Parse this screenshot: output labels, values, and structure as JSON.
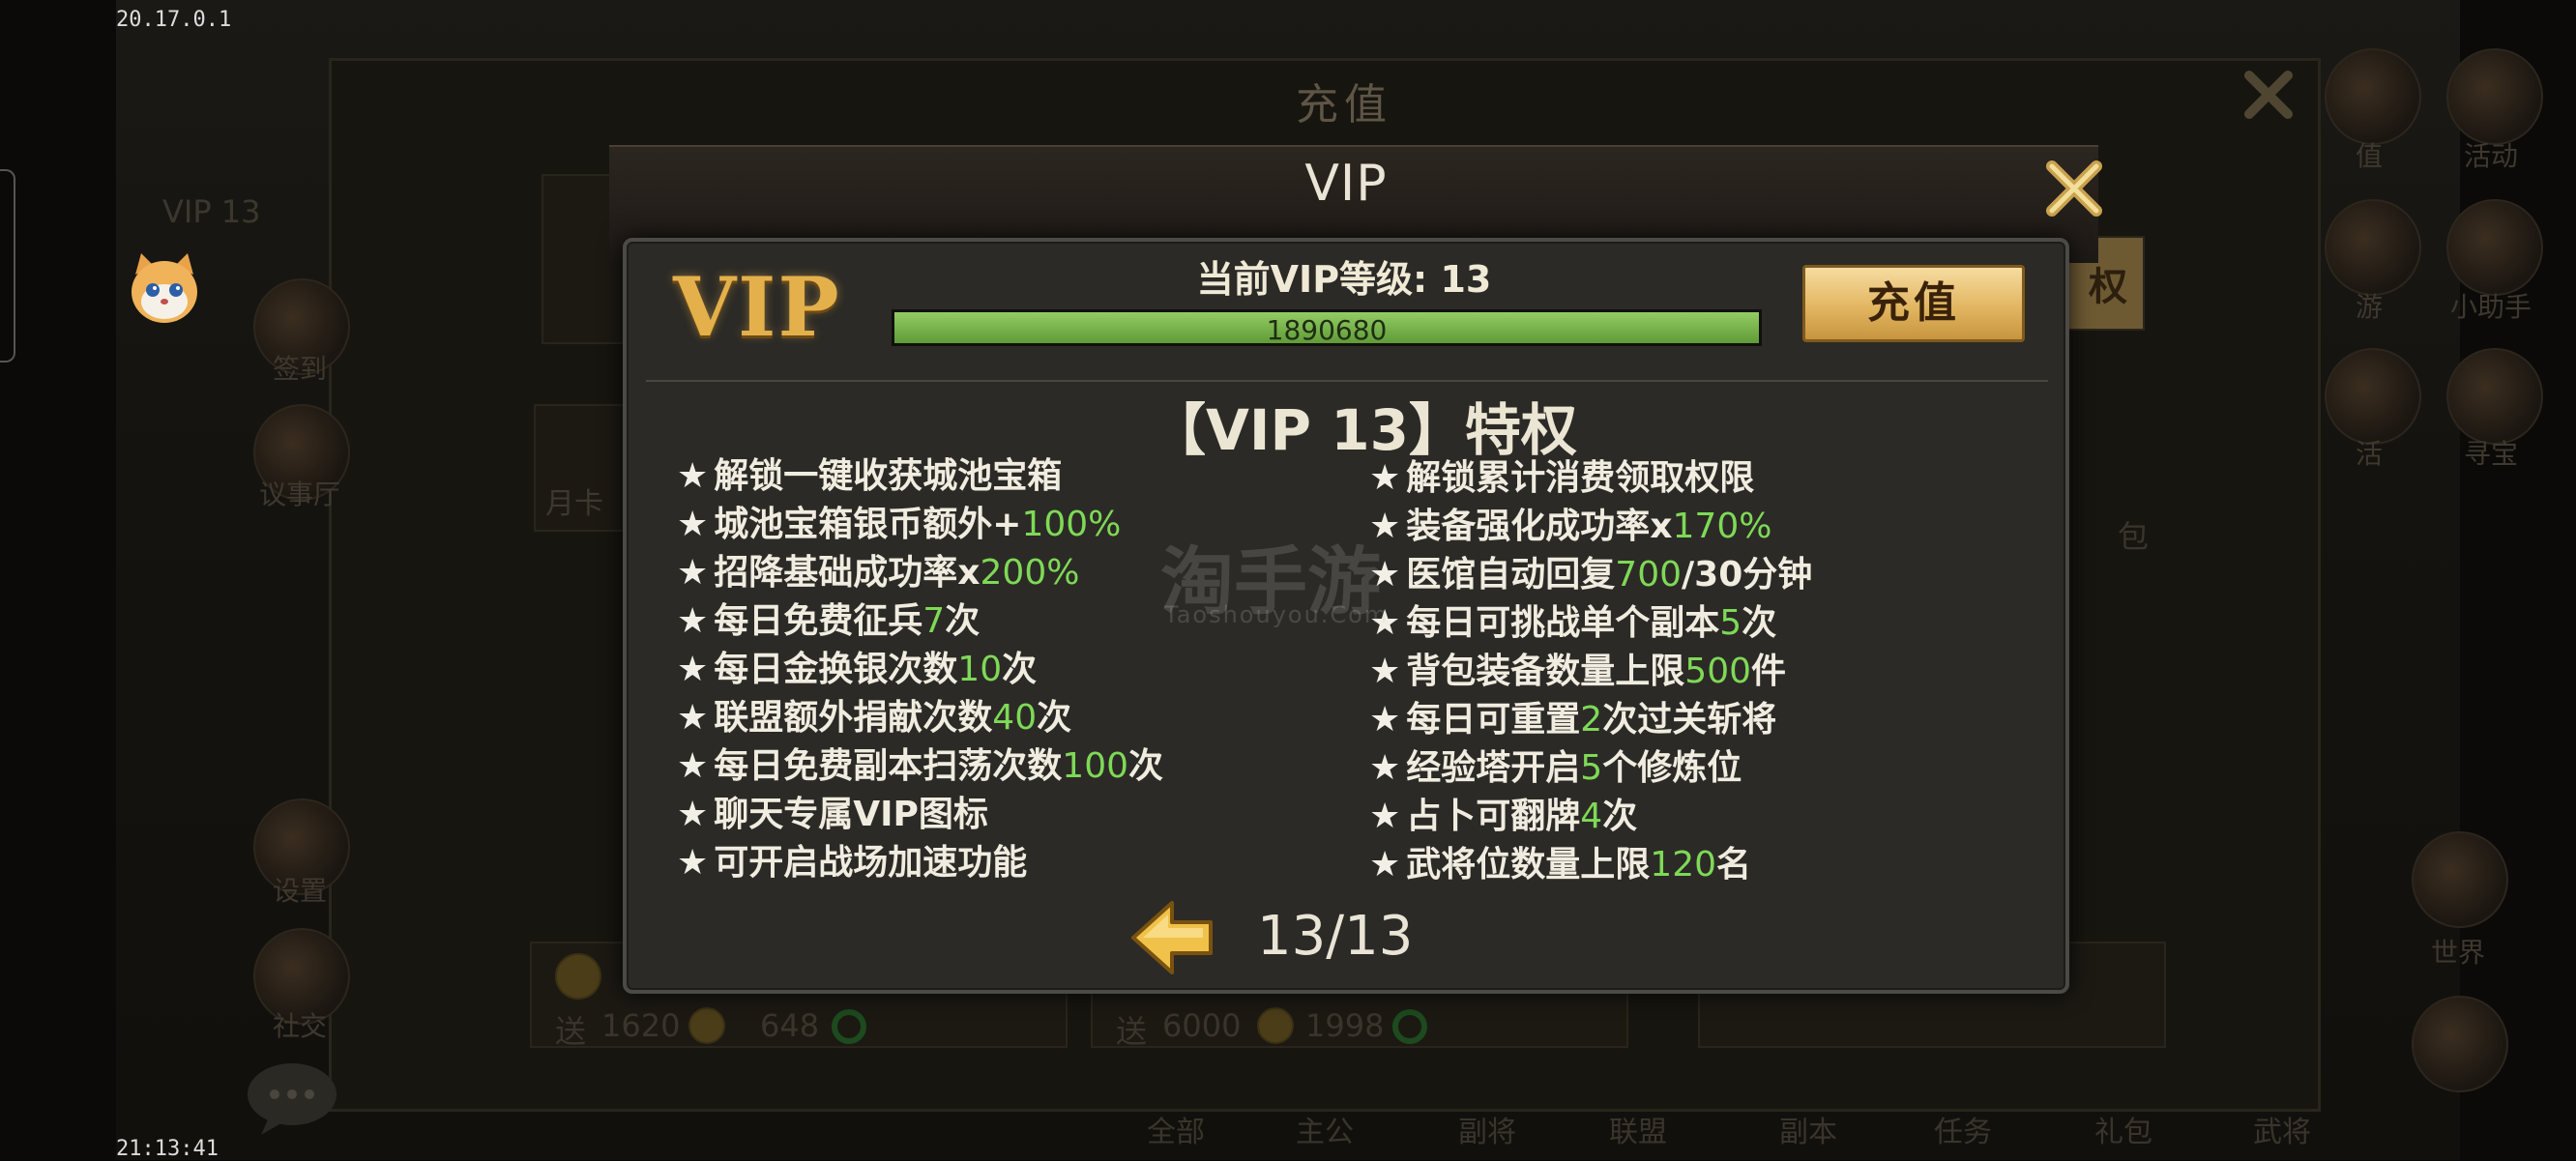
{
  "status": {
    "top_left": "20.17.0.1",
    "bottom_left": "21:13:41"
  },
  "background": {
    "title": "充值",
    "vip_label": "VIP 13",
    "left_icons": [
      "签到",
      "议事厅",
      "设置",
      "社交"
    ],
    "right_icons_top": [
      "值",
      "活动"
    ],
    "right_icons_mid": [
      "游",
      "小助手"
    ],
    "right_icons_low": [
      "活",
      "寻宝"
    ],
    "right_world": "世界",
    "right_partial": "权",
    "right_bag": "包",
    "month_card": "月卡",
    "cards": [
      {
        "send": "送",
        "amount": "1620",
        "jade": "648"
      },
      {
        "send": "送",
        "amount": "6000",
        "jade": "1998"
      }
    ],
    "bottom_tabs": [
      "全部",
      "主公",
      "副将",
      "联盟",
      "副本",
      "任务",
      "礼包",
      "武将",
      "世界"
    ]
  },
  "modal": {
    "title": "VIP",
    "logo": "VIP",
    "level_text": "当前VIP等级: 13",
    "progress_value": "1890680",
    "progress_fraction": 1.0,
    "recharge_button": "充值",
    "privilege_title": "【VIP 13】特权",
    "left_privileges": [
      {
        "star": "★",
        "pre": "解锁一键收获城池宝箱",
        "hl": "",
        "post": ""
      },
      {
        "star": "★",
        "pre": "城池宝箱银币额外+",
        "hl": "100%",
        "post": ""
      },
      {
        "star": "★",
        "pre": "招降基础成功率x",
        "hl": "200%",
        "post": ""
      },
      {
        "star": "★",
        "pre": "每日免费征兵",
        "hl": "7",
        "post": "次"
      },
      {
        "star": "★",
        "pre": "每日金换银次数",
        "hl": "10",
        "post": "次"
      },
      {
        "star": "★",
        "pre": "联盟额外捐献次数",
        "hl": "40",
        "post": "次"
      },
      {
        "star": "★",
        "pre": "每日免费副本扫荡次数",
        "hl": "100",
        "post": "次"
      },
      {
        "star": "★",
        "pre": "聊天专属VIP图标",
        "hl": "",
        "post": ""
      },
      {
        "star": "★",
        "pre": "可开启战场加速功能",
        "hl": "",
        "post": ""
      }
    ],
    "right_privileges": [
      {
        "star": "★",
        "pre": "解锁累计消费领取权限",
        "hl": "",
        "post": ""
      },
      {
        "star": "★",
        "pre": "装备强化成功率x",
        "hl": "170%",
        "post": ""
      },
      {
        "star": "★",
        "pre": "医馆自动回复",
        "hl": "700",
        "post": "/30分钟"
      },
      {
        "star": "★",
        "pre": "每日可挑战单个副本",
        "hl": "5",
        "post": "次"
      },
      {
        "star": "★",
        "pre": "背包装备数量上限",
        "hl": "500",
        "post": "件"
      },
      {
        "star": "★",
        "pre": "每日可重置",
        "hl": "2",
        "post": "次过关斩将"
      },
      {
        "star": "★",
        "pre": "经验塔开启",
        "hl": "5",
        "post": "个修炼位"
      },
      {
        "star": "★",
        "pre": "占卜可翻牌",
        "hl": "4",
        "post": "次"
      },
      {
        "star": "★",
        "pre": "武将位数量上限",
        "hl": "120",
        "post": "名"
      }
    ],
    "page_indicator": "13/13"
  },
  "watermark": {
    "main": "淘手游",
    "sub": "Taoshouyou.Com"
  },
  "colors": {
    "highlight": "#7ed957",
    "progress": "#7ab84a",
    "button_gold": "#e2b662"
  }
}
